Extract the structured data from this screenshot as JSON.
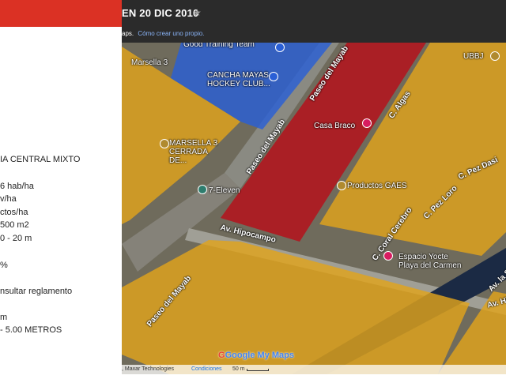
{
  "header": {
    "title": "EN 20 DIC 2010",
    "star_icon": "star-icon",
    "subtitle_prefix": "aps.",
    "subtitle_link": "Cómo crear uno propio."
  },
  "legend": {
    "lines": [
      "IA CENTRAL MIXTO",
      "6 hab/ha",
      "v/ha",
      "ctos/ha",
      "500 m2",
      "0 - 20 m",
      "%",
      "nsultar reglamento",
      "m",
      "- 5.00 METROS"
    ]
  },
  "map": {
    "zone_colors": {
      "orange": "#e0a31c",
      "blue": "#2a5fd6",
      "red": "#b5121b"
    },
    "places": [
      "Good Training Team",
      "CANCHA MAYAS HOCKEY CLUB...",
      "Marsella 3",
      "MARSELLA 3 CERRADA DE...",
      "7-Eleven",
      "Casa Braco",
      "Productos GAES",
      "Espacio Yocte Playa del Carmen",
      "UBBJ"
    ],
    "streets": [
      "Paseo del Mayab",
      "Paseo del Mayab",
      "Av. Hipocampo",
      "Paseo del Mayab",
      "C. Algas",
      "C. Pez Dasi",
      "C. Pez Loro",
      "C. Coral Cerebro",
      "Av. la S",
      "Av. Hi"
    ],
    "logo": "Google My Maps"
  },
  "footer": {
    "imagery": ", Maxar Technologies",
    "terms": "Condiciones",
    "scale": "50 m"
  }
}
